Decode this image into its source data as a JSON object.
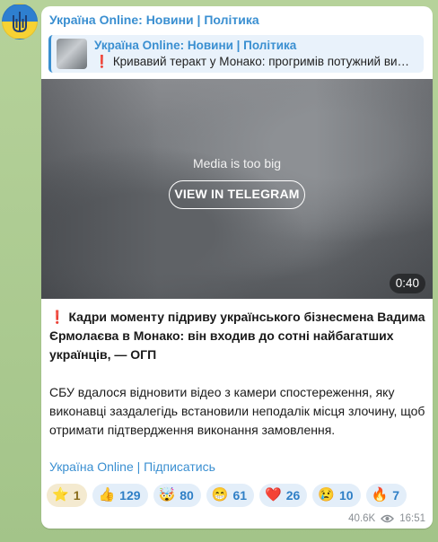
{
  "channel": {
    "name": "Україна Online: Новини | Політика"
  },
  "reply": {
    "title": "Україна Online: Новини | Політика",
    "text_prefix": "❗",
    "text": "Кривавий теракт у Монако: прогримів потужний ви…"
  },
  "media": {
    "message": "Media is too big",
    "button_label": "VIEW IN TELEGRAM",
    "duration": "0:40"
  },
  "post": {
    "headline_prefix": "❗",
    "headline": "Кадри моменту підриву українського бізнесмена Вадима Єрмолаєва в Монако: він входив до сотні найбагатших українців, — ОГП",
    "body": "СБУ вдалося відновити відео з камери спостереження, яку виконавці заздалегідь встановили неподалік місця злочину, щоб отримати підтвердження виконання замовлення.",
    "subscribe_link": "Україна Online | Підписатись"
  },
  "reactions": [
    {
      "emoji": "⭐",
      "icon": "star-icon",
      "count": "1"
    },
    {
      "emoji": "👍",
      "icon": "thumbs-up-icon",
      "count": "129"
    },
    {
      "emoji": "🤯",
      "icon": "exploding-head-icon",
      "count": "80"
    },
    {
      "emoji": "😁",
      "icon": "grin-icon",
      "count": "61"
    },
    {
      "emoji": "❤️",
      "icon": "heart-icon",
      "count": "26"
    },
    {
      "emoji": "😢",
      "icon": "crying-icon",
      "count": "10"
    },
    {
      "emoji": "🔥",
      "icon": "fire-icon",
      "count": "7"
    }
  ],
  "meta": {
    "views": "40.6K",
    "views_icon": "eye-icon",
    "time": "16:51"
  },
  "colors": {
    "accent": "#3a8fd1",
    "reaction_bg": "#e3eef9"
  }
}
